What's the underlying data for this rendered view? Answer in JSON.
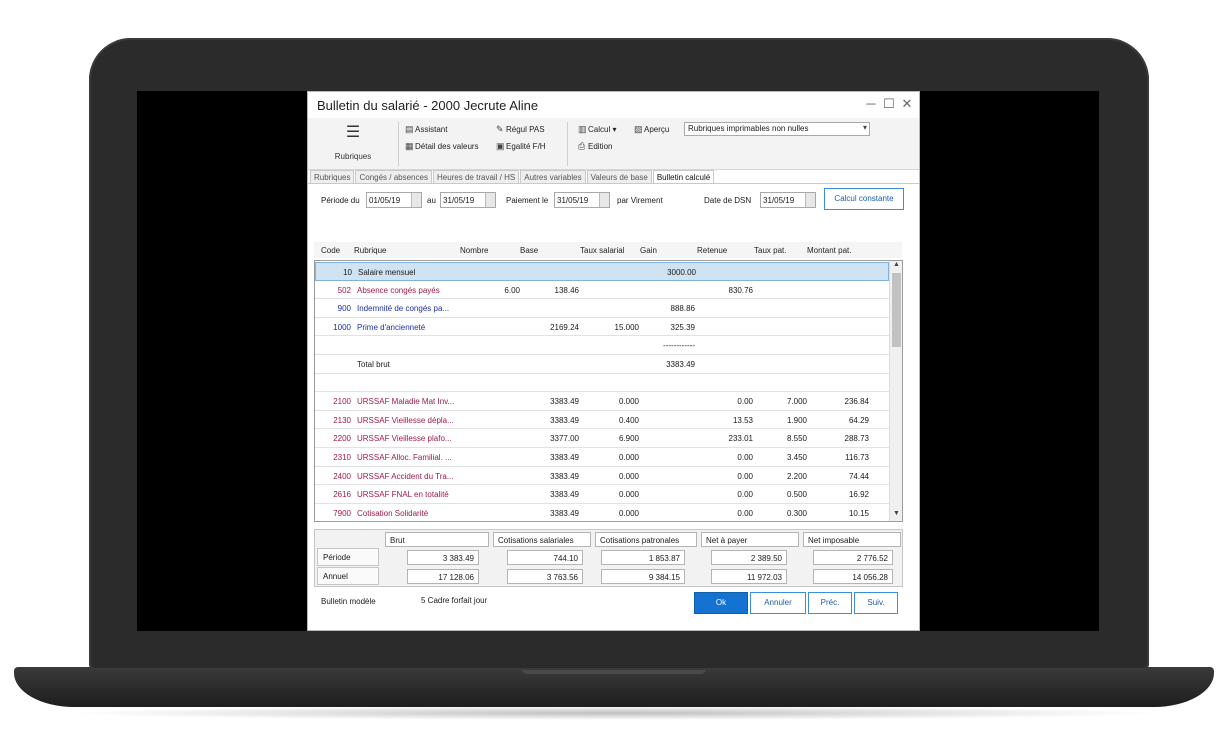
{
  "window": {
    "title": "Bulletin du salarié - 2000 Jecrute Aline",
    "controls": {
      "minimize": "─",
      "maximize": "☐",
      "close": "✕"
    }
  },
  "ribbon": {
    "rubriques": "Rubriques",
    "assistant": "Assistant",
    "detail_valeurs": "Détail des valeurs",
    "regul_pas": "Régul PAS",
    "egalite": "Egalité F/H",
    "calcul": "Calcul",
    "apercu": "Aperçu",
    "edition": "Edition",
    "filter_value": "Rubriques imprimables non nulles"
  },
  "tabs": [
    "Rubriques",
    "Congés / absences",
    "Heures de travail / HS",
    "Autres variables",
    "Valeurs de base",
    "Bulletin calculé"
  ],
  "active_tab": "Bulletin calculé",
  "fields": {
    "periode_du_label": "Période du",
    "periode_du": "01/05/19",
    "au_label": "au",
    "au": "31/05/19",
    "paiement_label": "Paiement le",
    "paiement": "31/05/19",
    "par_label": "par",
    "par_value": "Virement",
    "dsn_label": "Date de DSN",
    "dsn": "31/05/19",
    "calcul_constante": "Calcul constante"
  },
  "columns": [
    "Code",
    "Rubrique",
    "Nombre",
    "Base",
    "Taux salarial",
    "Gain",
    "Retenue",
    "Taux pat.",
    "Montant pat."
  ],
  "rows": [
    {
      "code": "10",
      "rubrique": "Salaire mensuel",
      "nombre": "",
      "base": "",
      "taux": "",
      "gain": "3000.00",
      "retenue": "",
      "taux_pat": "",
      "montant_pat": "",
      "color": "#1a1a1a",
      "selected": true
    },
    {
      "code": "502",
      "rubrique": "Absence congés payés",
      "nombre": "6.00",
      "base": "138.46",
      "taux": "",
      "gain": "",
      "retenue": "830.76",
      "taux_pat": "",
      "montant_pat": "",
      "color": "#a01a4a"
    },
    {
      "code": "900",
      "rubrique": "Indemnité de congés pa...",
      "nombre": "",
      "base": "",
      "taux": "",
      "gain": "888.86",
      "retenue": "",
      "taux_pat": "",
      "montant_pat": "",
      "color": "#1b2fb0"
    },
    {
      "code": "1000",
      "rubrique": "Prime d'ancienneté",
      "nombre": "",
      "base": "2169.24",
      "taux": "15.000",
      "gain": "325.39",
      "retenue": "",
      "taux_pat": "",
      "montant_pat": "",
      "color": "#1b2fb0"
    },
    {
      "code": "",
      "rubrique": "",
      "nombre": "",
      "base": "",
      "taux": "",
      "gain": "------------",
      "retenue": "",
      "taux_pat": "",
      "montant_pat": "",
      "color": "#1a1a1a"
    },
    {
      "code": "",
      "rubrique": "Total brut",
      "nombre": "",
      "base": "",
      "taux": "",
      "gain": "3383.49",
      "retenue": "",
      "taux_pat": "",
      "montant_pat": "",
      "color": "#1a1a1a"
    },
    {
      "code": "",
      "rubrique": "",
      "nombre": "",
      "base": "",
      "taux": "",
      "gain": "",
      "retenue": "",
      "taux_pat": "",
      "montant_pat": "",
      "color": "#1a1a1a"
    },
    {
      "code": "2100",
      "rubrique": "URSSAF Maladie Mat Inv...",
      "nombre": "",
      "base": "3383.49",
      "taux": "0.000",
      "gain": "",
      "retenue": "0.00",
      "taux_pat": "7.000",
      "montant_pat": "236.84",
      "color": "#a01a4a"
    },
    {
      "code": "2130",
      "rubrique": "URSSAF Vieillesse dépla...",
      "nombre": "",
      "base": "3383.49",
      "taux": "0.400",
      "gain": "",
      "retenue": "13.53",
      "taux_pat": "1.900",
      "montant_pat": "64.29",
      "color": "#a01a4a"
    },
    {
      "code": "2200",
      "rubrique": "URSSAF Vieillesse plafo...",
      "nombre": "",
      "base": "3377.00",
      "taux": "6.900",
      "gain": "",
      "retenue": "233.01",
      "taux_pat": "8.550",
      "montant_pat": "288.73",
      "color": "#a01a4a"
    },
    {
      "code": "2310",
      "rubrique": "URSSAF Alloc. Familial. ...",
      "nombre": "",
      "base": "3383.49",
      "taux": "0.000",
      "gain": "",
      "retenue": "0.00",
      "taux_pat": "3.450",
      "montant_pat": "116.73",
      "color": "#a01a4a"
    },
    {
      "code": "2400",
      "rubrique": "URSSAF Accident du Tra...",
      "nombre": "",
      "base": "3383.49",
      "taux": "0.000",
      "gain": "",
      "retenue": "0.00",
      "taux_pat": "2.200",
      "montant_pat": "74.44",
      "color": "#a01a4a"
    },
    {
      "code": "2616",
      "rubrique": "URSSAF FNAL en totalité",
      "nombre": "",
      "base": "3383.49",
      "taux": "0.000",
      "gain": "",
      "retenue": "0.00",
      "taux_pat": "0.500",
      "montant_pat": "16.92",
      "color": "#a01a4a"
    },
    {
      "code": "7900",
      "rubrique": "Cotisation Solidarité",
      "nombre": "",
      "base": "3383.49",
      "taux": "0.000",
      "gain": "",
      "retenue": "0.00",
      "taux_pat": "0.300",
      "montant_pat": "10.15",
      "color": "#a01a4a"
    }
  ],
  "totals": {
    "headers": [
      "Brut",
      "Cotisations salariales",
      "Cotisations patronales",
      "Net à payer",
      "Net imposable"
    ],
    "periode_label": "Période",
    "annuel_label": "Annuel",
    "periode": [
      "3 383.49",
      "744.10",
      "1 853.87",
      "2 389.50",
      "2 776.52"
    ],
    "annuel": [
      "17 128.06",
      "3 763.56",
      "9 384.15",
      "11 972.03",
      "14 056.28"
    ]
  },
  "footer": {
    "bulletin_modele_label": "Bulletin modèle",
    "bulletin_modele_value": "5 Cadre forfait jour",
    "ok": "Ok",
    "annuler": "Annuler",
    "prec": "Préc.",
    "suiv": "Suiv."
  }
}
